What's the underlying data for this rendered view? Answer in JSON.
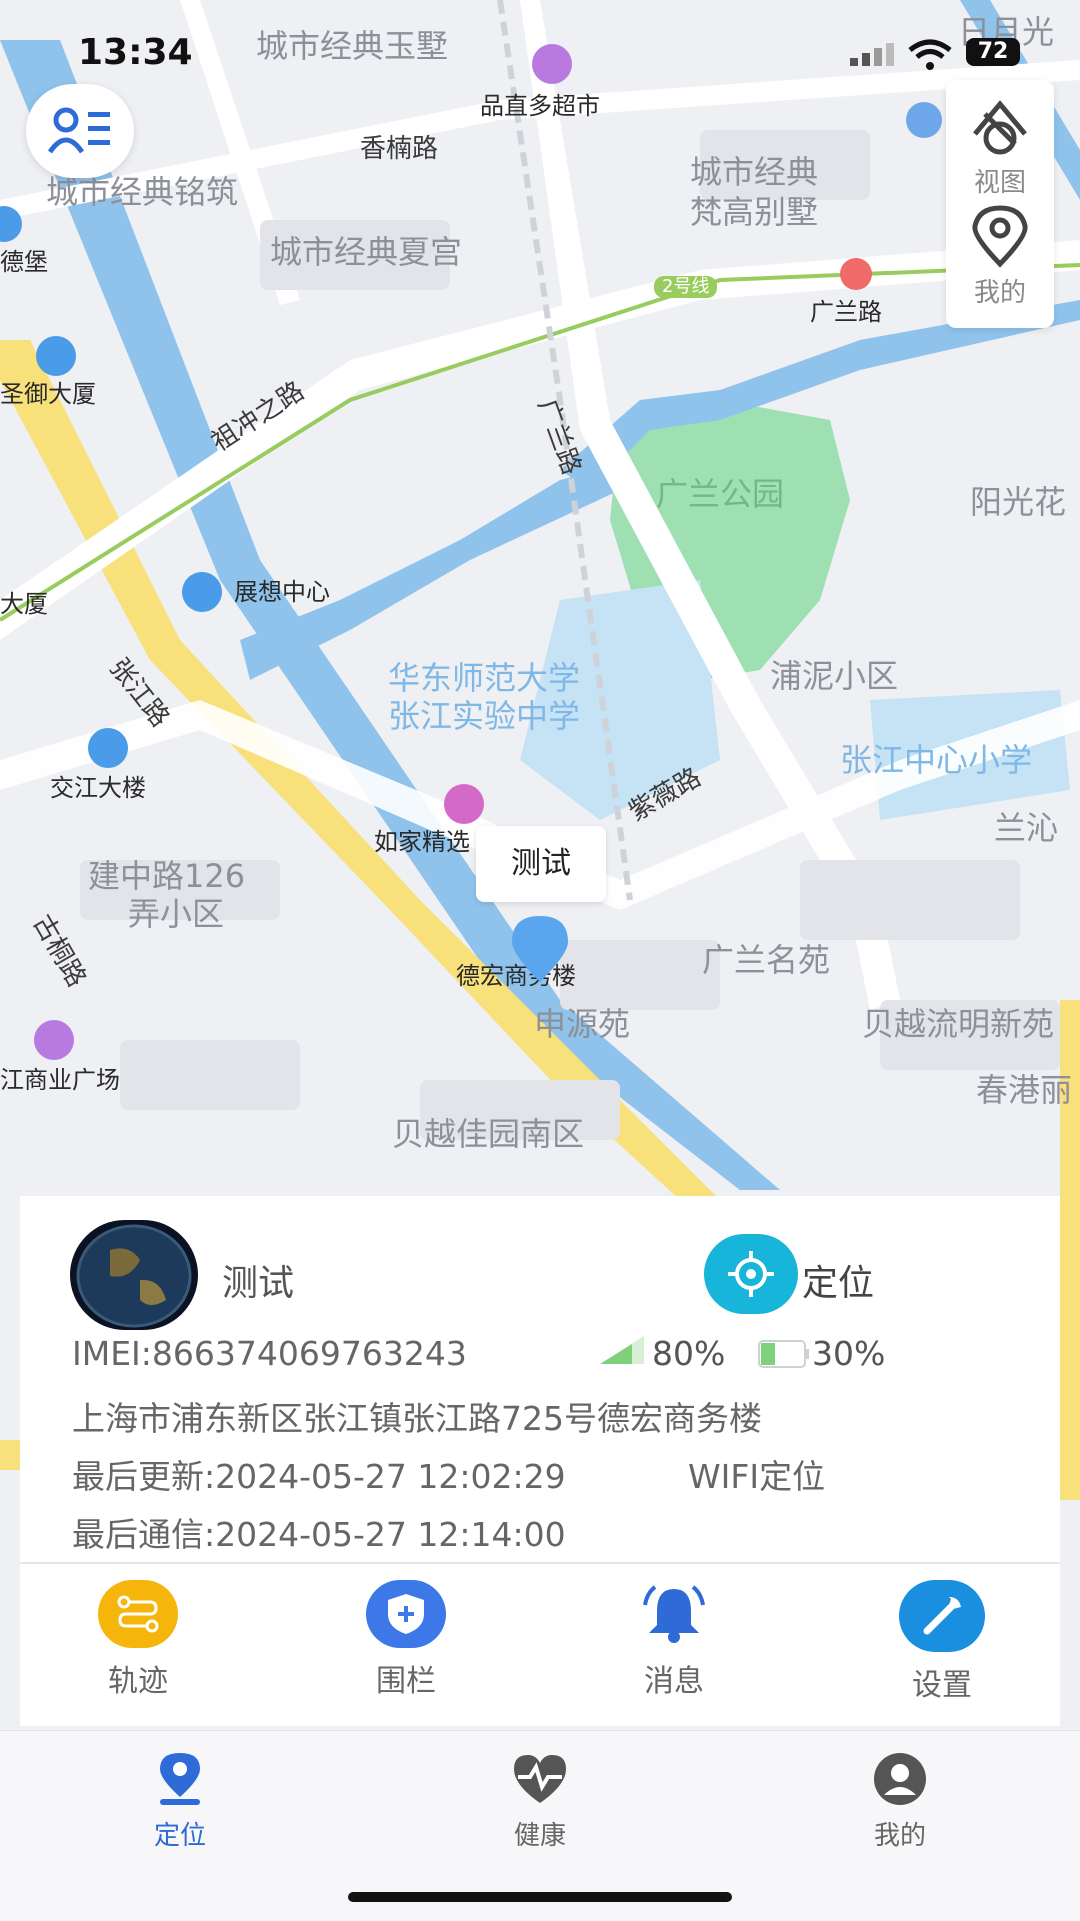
{
  "status_bar": {
    "time": "13:34",
    "battery": "72"
  },
  "map": {
    "labels": {
      "l1": "城市经典玉墅",
      "l2": "品直多超市",
      "l3": "香楠路",
      "l4": "城市经典铭筑",
      "l5": "城市经典",
      "l6": "梵高别墅",
      "l7": "城市经典夏宫",
      "l8": "广兰路",
      "l9": "圣御大厦",
      "l10": "祖冲之路",
      "l11": "广兰路",
      "l12": "广兰公园",
      "l13": "阳光花",
      "l14": "展想中心",
      "l15": "张江路",
      "l16": "华东师范大学",
      "l17": "张江实验中学",
      "l18": "浦泥小区",
      "l19": "交江大楼",
      "l20": "张江中心小学",
      "l21": "紫薇路",
      "l22": "兰沁",
      "l23": "如家精选",
      "l24": "建中路126",
      "l25": "弄小区",
      "l26": "古桐路",
      "l27": "德宏商务楼",
      "l28": "广兰名苑",
      "l29": "申源苑",
      "l30": "贝越流明新苑",
      "l31": "江商业广场",
      "l32": "春港丽",
      "l33": "贝越佳园南区",
      "l34": "日月光",
      "l35": "德堡",
      "l36": "大厦",
      "l37": "2号线"
    },
    "marker_label": "测试"
  },
  "right_panel": {
    "view_label": "视图",
    "mine_label": "我的"
  },
  "device": {
    "name": "测试",
    "locate_label": "定位",
    "imei": "IMEI:866374069763243",
    "signal": "80%",
    "battery": "30%",
    "address": "上海市浦东新区张江镇张江路725号德宏商务楼",
    "last_update": "最后更新:2024-05-27 12:02:29",
    "loc_type": "WIFI定位",
    "last_comm": "最后通信:2024-05-27 12:14:00"
  },
  "actions": {
    "track": "轨迹",
    "fence": "围栏",
    "message": "消息",
    "settings": "设置"
  },
  "tabs": {
    "locate": "定位",
    "health": "健康",
    "mine": "我的"
  },
  "colors": {
    "accent": "#2e6bd6",
    "locate_btn": "#16b5d9",
    "track_btn": "#f5b50a",
    "fence_btn": "#3d78e8",
    "settings_btn": "#1a8fe0",
    "pin": "#5aa6ee"
  }
}
